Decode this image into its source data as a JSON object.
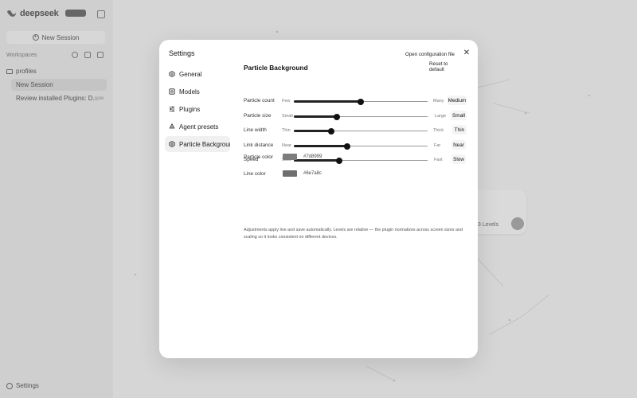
{
  "app": {
    "brand": "deepseek",
    "new_session": "New Session",
    "workspaces_label": "Workspaces",
    "folder": "profiles",
    "sessions": [
      {
        "label": "New Session",
        "time": ""
      },
      {
        "label": "Review installed Plugins: D...",
        "time": "now"
      }
    ],
    "settings_label": "Settings",
    "bg_card_text": "3 Levels"
  },
  "modal": {
    "title": "Settings",
    "open_config": "Open configuration file",
    "nav": [
      {
        "label": "General",
        "icon": "hexagon-icon"
      },
      {
        "label": "Models",
        "icon": "cube-icon"
      },
      {
        "label": "Plugins",
        "icon": "sliders-icon"
      },
      {
        "label": "Agent presets",
        "icon": "recycle-icon"
      },
      {
        "label": "Particle Background",
        "icon": "hexagon-icon"
      }
    ],
    "panel": {
      "title": "Particle Background",
      "reset": "Reset to default",
      "sliders": [
        {
          "label": "Particle count",
          "min": "Few",
          "max": "Many",
          "value": "Medium",
          "level": 0.5
        },
        {
          "label": "Particle size",
          "min": "Small",
          "max": "Large",
          "value": "Small",
          "level": 0.32
        },
        {
          "label": "Line width",
          "min": "Thin",
          "max": "Thick",
          "value": "Thin",
          "level": 0.28
        },
        {
          "label": "Link distance",
          "min": "Near",
          "max": "Far",
          "value": "Near",
          "level": 0.4
        },
        {
          "label": "Speed",
          "min": "Slow",
          "max": "Fast",
          "value": "Slow",
          "level": 0.34
        }
      ],
      "colors": [
        {
          "label": "Particle color",
          "hex": "#7d8999",
          "swatch": "#7d7d7d"
        },
        {
          "label": "Line color",
          "hex": "#6e7a8c",
          "swatch": "#6e6e6e"
        }
      ],
      "footnote": "Adjustments apply live and save automatically. Levels are relative — the plugin normalizes across screen sizes and scaling so it looks consistent on different devices."
    }
  }
}
